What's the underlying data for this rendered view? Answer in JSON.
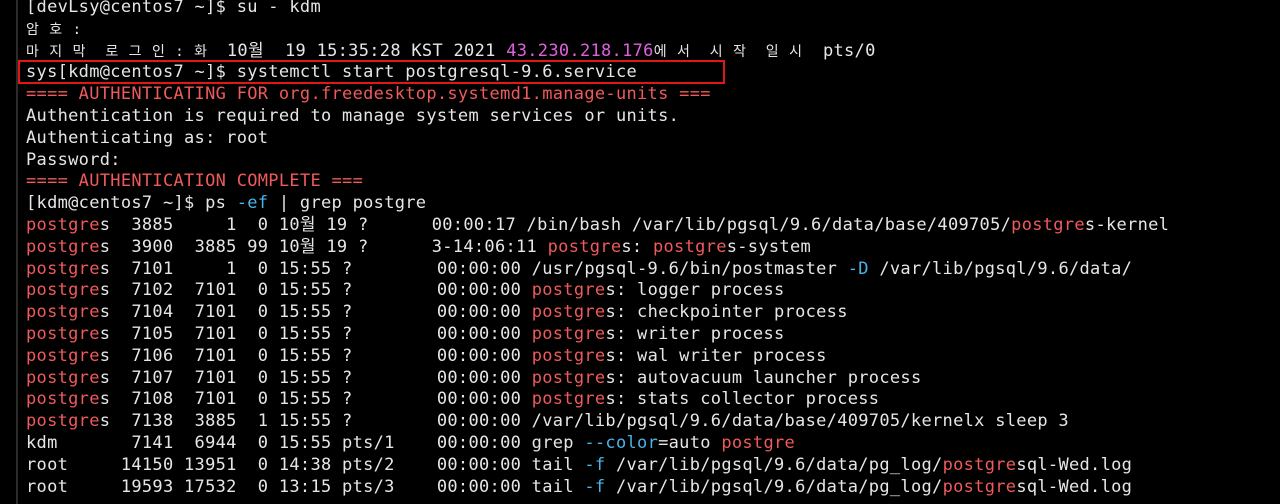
{
  "terminal": {
    "lines": [
      {
        "segments": [
          {
            "text": "[devLsy@centos7 ~]$ su - kdm",
            "color": "#e6e6e6"
          }
        ]
      },
      {
        "segments": [
          {
            "text": "암 호 :",
            "color": "#e6e6e6",
            "small": true
          }
        ]
      },
      {
        "segments": [
          {
            "text": "마 지 막  로 그 인 : 화  ",
            "color": "#e6e6e6",
            "small": true
          },
          {
            "text": "10월  19 15:35:28 KST 2021 ",
            "color": "#e6e6e6"
          },
          {
            "text": "43.230.218.176",
            "color": "#e060e0"
          },
          {
            "text": "에 서  시 작  일 시 ",
            "color": "#e6e6e6",
            "small": true
          },
          {
            "text": " pts/0",
            "color": "#e6e6e6"
          }
        ]
      },
      {
        "segments": [
          {
            "text": "sys[kdm@centos7 ~]$ systemctl start postgresql-9.6.service",
            "color": "#e6e6e6"
          }
        ]
      },
      {
        "segments": [
          {
            "text": "==== AUTHENTICATING FOR org.freedesktop.systemd1.manage-units ===",
            "color": "#ef5a5a"
          }
        ]
      },
      {
        "segments": [
          {
            "text": "Authentication is required to manage system services or units.",
            "color": "#e6e6e6"
          }
        ]
      },
      {
        "segments": [
          {
            "text": "Authenticating as: root",
            "color": "#e6e6e6"
          }
        ]
      },
      {
        "segments": [
          {
            "text": "Password:",
            "color": "#e6e6e6"
          }
        ]
      },
      {
        "segments": [
          {
            "text": "==== AUTHENTICATION COMPLETE ===",
            "color": "#ef5a5a"
          }
        ]
      },
      {
        "segments": [
          {
            "text": "[kdm@centos7 ~]$ ps ",
            "color": "#e6e6e6"
          },
          {
            "text": "-ef",
            "color": "#4ab3e8"
          },
          {
            "text": " | grep postgre",
            "color": "#e6e6e6"
          }
        ]
      },
      {
        "segments": [
          {
            "text": "postgre",
            "color": "#ef5a5a"
          },
          {
            "text": "s  3885     1  0 10월 19 ?      00:00:17 /bin/bash /var/lib/pgsql/9.6/data/base/409705/",
            "color": "#e6e6e6"
          },
          {
            "text": "postgre",
            "color": "#ef5a5a"
          },
          {
            "text": "s-kernel",
            "color": "#e6e6e6"
          }
        ]
      },
      {
        "segments": [
          {
            "text": "postgre",
            "color": "#ef5a5a"
          },
          {
            "text": "s  3900  3885 99 10월 19 ?      3-14:06:11 ",
            "color": "#e6e6e6"
          },
          {
            "text": "postgre",
            "color": "#ef5a5a"
          },
          {
            "text": "s: ",
            "color": "#e6e6e6"
          },
          {
            "text": "postgre",
            "color": "#ef5a5a"
          },
          {
            "text": "s-system",
            "color": "#e6e6e6"
          }
        ]
      },
      {
        "segments": [
          {
            "text": "postgre",
            "color": "#ef5a5a"
          },
          {
            "text": "s  7101     1  0 15:55 ?        00:00:00 /usr/pgsql-9.6/bin/postmaster ",
            "color": "#e6e6e6"
          },
          {
            "text": "-D",
            "color": "#4ab3e8"
          },
          {
            "text": " /var/lib/pgsql/9.6/data/",
            "color": "#e6e6e6"
          }
        ]
      },
      {
        "segments": [
          {
            "text": "postgre",
            "color": "#ef5a5a"
          },
          {
            "text": "s  7102  7101  0 15:55 ?        00:00:00 ",
            "color": "#e6e6e6"
          },
          {
            "text": "postgre",
            "color": "#ef5a5a"
          },
          {
            "text": "s: logger process",
            "color": "#e6e6e6"
          }
        ]
      },
      {
        "segments": [
          {
            "text": "postgre",
            "color": "#ef5a5a"
          },
          {
            "text": "s  7104  7101  0 15:55 ?        00:00:00 ",
            "color": "#e6e6e6"
          },
          {
            "text": "postgre",
            "color": "#ef5a5a"
          },
          {
            "text": "s: checkpointer process",
            "color": "#e6e6e6"
          }
        ]
      },
      {
        "segments": [
          {
            "text": "postgre",
            "color": "#ef5a5a"
          },
          {
            "text": "s  7105  7101  0 15:55 ?        00:00:00 ",
            "color": "#e6e6e6"
          },
          {
            "text": "postgre",
            "color": "#ef5a5a"
          },
          {
            "text": "s: writer process",
            "color": "#e6e6e6"
          }
        ]
      },
      {
        "segments": [
          {
            "text": "postgre",
            "color": "#ef5a5a"
          },
          {
            "text": "s  7106  7101  0 15:55 ?        00:00:00 ",
            "color": "#e6e6e6"
          },
          {
            "text": "postgre",
            "color": "#ef5a5a"
          },
          {
            "text": "s: wal writer process",
            "color": "#e6e6e6"
          }
        ]
      },
      {
        "segments": [
          {
            "text": "postgre",
            "color": "#ef5a5a"
          },
          {
            "text": "s  7107  7101  0 15:55 ?        00:00:00 ",
            "color": "#e6e6e6"
          },
          {
            "text": "postgre",
            "color": "#ef5a5a"
          },
          {
            "text": "s: autovacuum launcher process",
            "color": "#e6e6e6"
          }
        ]
      },
      {
        "segments": [
          {
            "text": "postgre",
            "color": "#ef5a5a"
          },
          {
            "text": "s  7108  7101  0 15:55 ?        00:00:00 ",
            "color": "#e6e6e6"
          },
          {
            "text": "postgre",
            "color": "#ef5a5a"
          },
          {
            "text": "s: stats collector process",
            "color": "#e6e6e6"
          }
        ]
      },
      {
        "segments": [
          {
            "text": "postgre",
            "color": "#ef5a5a"
          },
          {
            "text": "s  7138  3885  1 15:55 ?        00:00:00 /var/lib/pgsql/9.6/data/base/409705/kernelx sleep 3",
            "color": "#e6e6e6"
          }
        ]
      },
      {
        "segments": [
          {
            "text": "kdm       7141  6944  0 15:55 pts/1    00:00:00 grep ",
            "color": "#e6e6e6"
          },
          {
            "text": "--color",
            "color": "#4ab3e8"
          },
          {
            "text": "=auto ",
            "color": "#e6e6e6"
          },
          {
            "text": "postgre",
            "color": "#ef5a5a"
          }
        ]
      },
      {
        "segments": [
          {
            "text": "root     14150 13951  0 14:38 pts/2    00:00:00 tail ",
            "color": "#e6e6e6"
          },
          {
            "text": "-f",
            "color": "#4ab3e8"
          },
          {
            "text": " /var/lib/pgsql/9.6/data/pg_log/",
            "color": "#e6e6e6"
          },
          {
            "text": "postgre",
            "color": "#ef5a5a"
          },
          {
            "text": "sql-Wed.log",
            "color": "#e6e6e6"
          }
        ]
      },
      {
        "segments": [
          {
            "text": "root     19593 17532  0 13:15 pts/3    00:00:00 tail ",
            "color": "#e6e6e6"
          },
          {
            "text": "-f",
            "color": "#4ab3e8"
          },
          {
            "text": " /var/lib/pgsql/9.6/data/pg_log/",
            "color": "#e6e6e6"
          },
          {
            "text": "postgre",
            "color": "#ef5a5a"
          },
          {
            "text": "sql-Wed.log",
            "color": "#e6e6e6"
          }
        ]
      }
    ]
  },
  "highlight": {
    "color": "#e0161a",
    "line_index": 3
  },
  "colors": {
    "background": "#000000",
    "foreground": "#e6e6e6",
    "red": "#ef5a5a",
    "magenta": "#e060e0",
    "cyan": "#4ab3e8"
  }
}
